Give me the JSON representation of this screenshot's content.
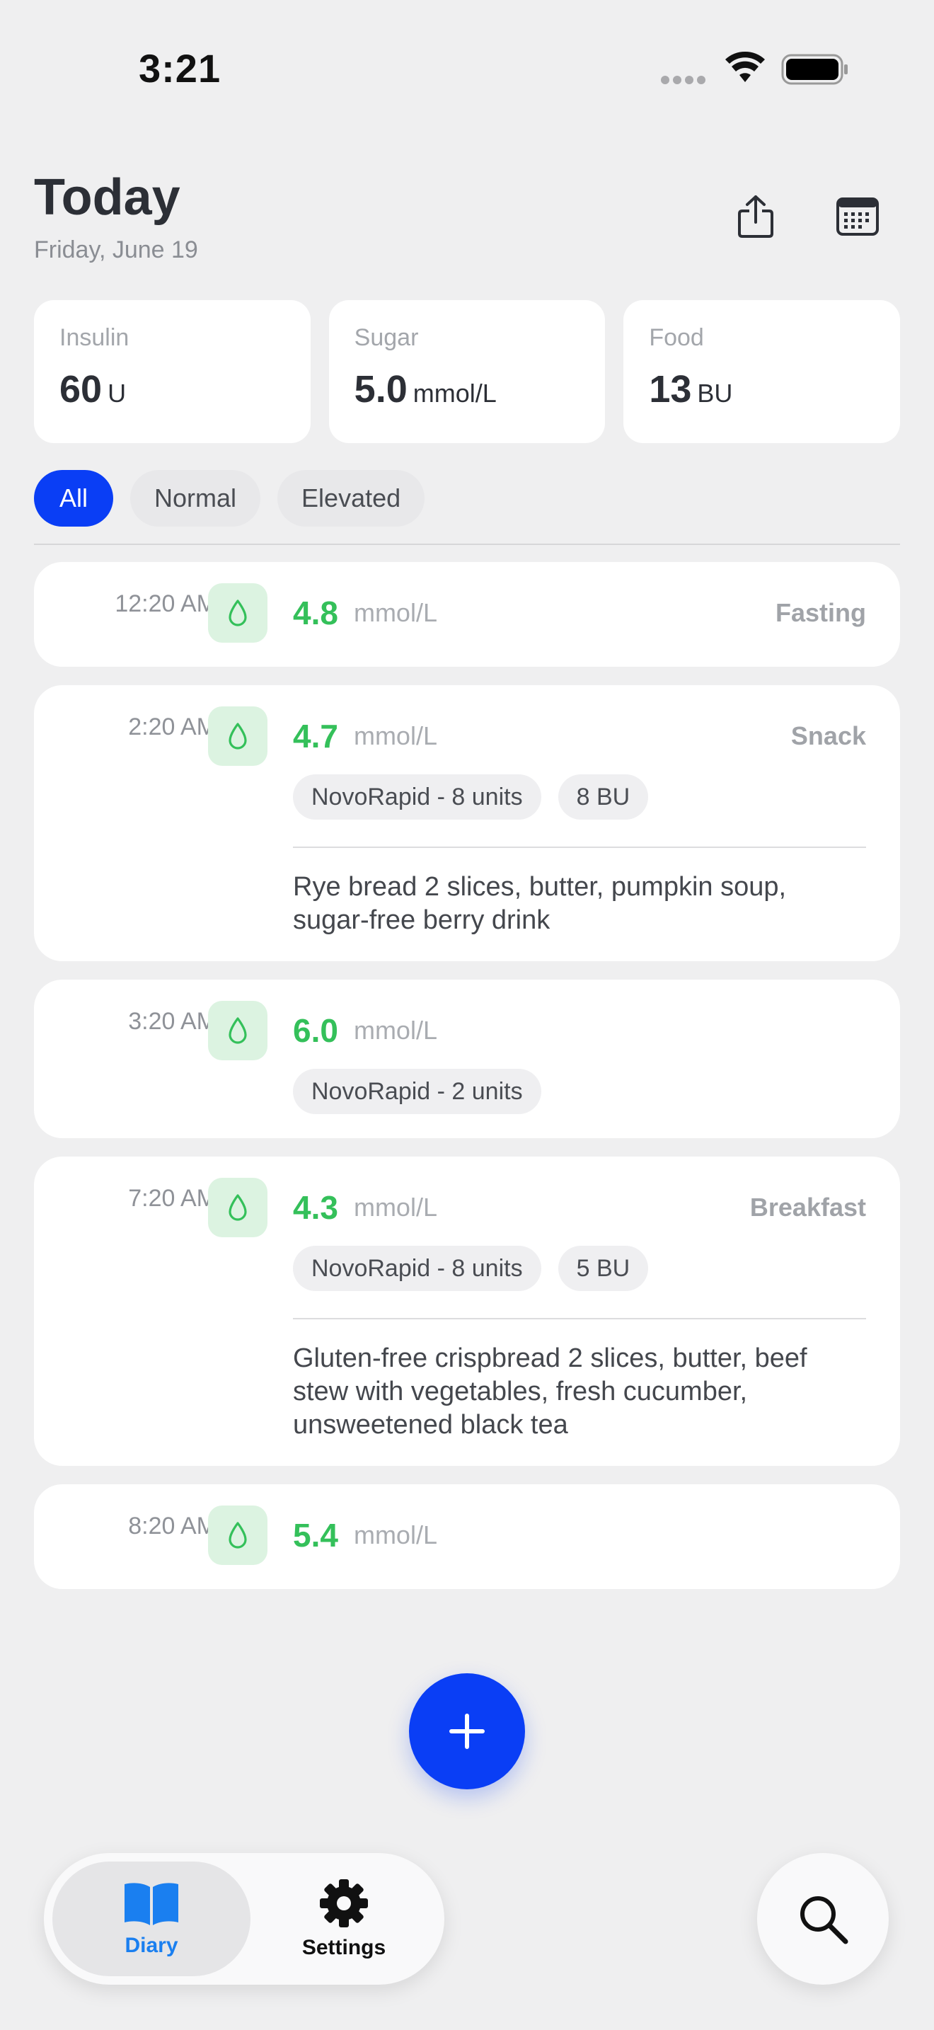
{
  "status_bar": {
    "time": "3:21"
  },
  "header": {
    "title": "Today",
    "date": "Friday, June 19"
  },
  "summary": [
    {
      "label": "Insulin",
      "value": "60",
      "unit": "U"
    },
    {
      "label": "Sugar",
      "value": "5.0",
      "unit": "mmol/L"
    },
    {
      "label": "Food",
      "value": "13",
      "unit": "BU"
    }
  ],
  "filters": [
    "All",
    "Normal",
    "Elevated"
  ],
  "entries": [
    {
      "time": "12:20 AM",
      "value": "4.8",
      "unit": "mmol/L",
      "tag": "Fasting"
    },
    {
      "time": "2:20 AM",
      "value": "4.7",
      "unit": "mmol/L",
      "tag": "Snack",
      "insulin": "NovoRapid - 8 units",
      "food_units": "8 BU",
      "note": "Rye bread 2 slices, butter, pumpkin soup, sugar-free berry drink"
    },
    {
      "time": "3:20 AM",
      "value": "6.0",
      "unit": "mmol/L",
      "insulin": "NovoRapid - 2 units"
    },
    {
      "time": "7:20 AM",
      "value": "4.3",
      "unit": "mmol/L",
      "tag": "Breakfast",
      "insulin": "NovoRapid - 8 units",
      "food_units": "5 BU",
      "note": "Gluten-free crispbread 2 slices, butter, beef stew with vegetables, fresh cucumber, unsweetened black tea"
    },
    {
      "time": "8:20 AM",
      "value": "5.4",
      "unit": "mmol/L"
    }
  ],
  "tabs": [
    {
      "label": "Diary",
      "icon": "book-icon"
    },
    {
      "label": "Settings",
      "icon": "gear-icon"
    }
  ],
  "colors": {
    "accent": "#0a3ef5",
    "reading_normal": "#34c05a",
    "tab_active": "#1a7ff0",
    "background": "#efeff0"
  }
}
